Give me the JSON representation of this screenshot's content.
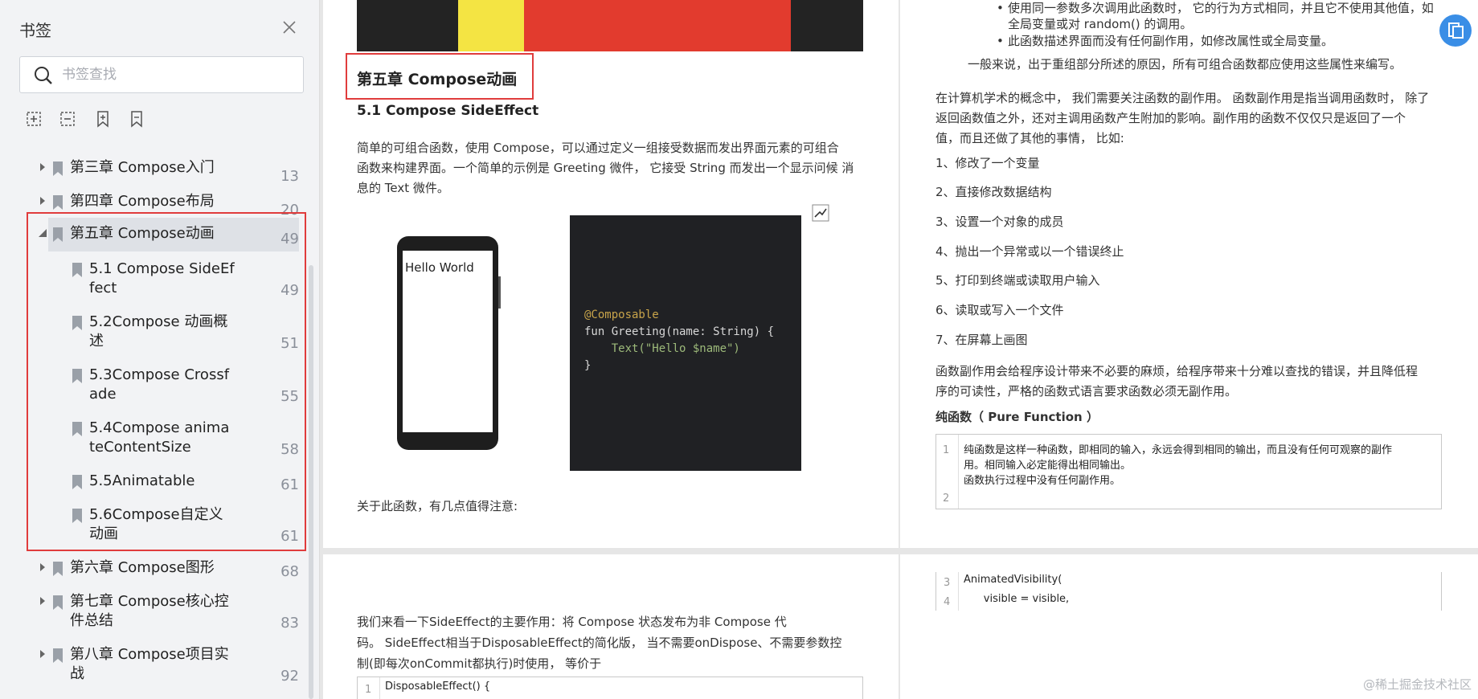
{
  "sidebar": {
    "title": "书签",
    "search_placeholder": "书签查找",
    "items": [
      {
        "label": "第三章 Compose入门",
        "page": "13"
      },
      {
        "label": "第四章 Compose布局",
        "page": "20"
      },
      {
        "label": "第五章 Compose动画",
        "page": "49"
      },
      {
        "label_1": "5.1 Compose SideEf",
        "label_2": "fect",
        "page": "49"
      },
      {
        "label_1": "5.2Compose 动画概",
        "label_2": "述",
        "page": "51"
      },
      {
        "label_1": "5.3Compose Crossf",
        "label_2": "ade",
        "page": "55"
      },
      {
        "label_1": "5.4Compose anima",
        "label_2": "teContentSize",
        "page": "58"
      },
      {
        "label": "5.5Animatable",
        "page": "61"
      },
      {
        "label_1": "5.6Compose自定义",
        "label_2": "动画",
        "page": "61"
      },
      {
        "label": "第六章 Compose图形",
        "page": "68"
      },
      {
        "label_1": "第七章 Compose核心控",
        "label_2": "件总结",
        "page": "83"
      },
      {
        "label_1": "第八章 Compose项目实",
        "label_2": "战",
        "page": "92"
      }
    ]
  },
  "left_page": {
    "chapter_title": "第五章 Compose动画",
    "section_title": "5.1 Compose SideEffect",
    "intro_lines": [
      "简单的可组合函数，使用 Compose，可以通过定义一组接受数据而发出界面元素的可组合",
      "函数来构建界面。一个简单的示例是 Greeting 微件，  它接受 String 而发出一个显示问候 消",
      "息的 Text 微件。"
    ],
    "phone_text": "Hello World",
    "code_lines": [
      "@Composable",
      "fun Greeting(name: String) {",
      "    Text(\"Hello $name\")",
      "}"
    ],
    "note": "关于此函数，有几点值得注意:"
  },
  "right_page": {
    "bullets": [
      "使用同一参数多次调用此函数时，   它的行为方式相同，并且它不使用其他值，如",
      "全局变量或对 random() 的调用。",
      "此函数描述界面而没有任何副作用，如修改属性或全局变量。"
    ],
    "summary": "一般来说，出于重组部分所述的原因，所有可组合函数都应使用这些属性来编写。",
    "concept_lines": [
      "在计算机学术的概念中，  我们需要关注函数的副作用。  函数副作用是指当调用函数时，   除了",
      "返回函数值之外，还对主调用函数产生附加的影响。副作用的函数不仅仅只是返回了一个",
      "值，而且还做了其他的事情，   比如:"
    ],
    "numbered": [
      "1、修改了一个变量",
      "2、直接修改数据结构",
      "3、设置一个对象的成员",
      "4、抛出一个异常或以一个错误终止",
      "5、打印到终端或读取用户输入",
      "6、读取或写入一个文件",
      "7、在屏幕上画图"
    ],
    "side_effect_lines": [
      "函数副作用会给程序设计带来不必要的麻烦，给程序带来十分难以查找的错误，并且降低程",
      "序的可读性，严格的函数式语言要求函数必须无副作用。"
    ],
    "pure_heading": "纯函数（ Pure Function ）",
    "pure_code": {
      "line_nums": [
        "1",
        "2"
      ],
      "lines": [
        "纯函数是这样一种函数，即相同的输入，永远会得到相同的输出，而且没有任何可观察的副作",
        "用。相同输入必定能得出相同输出。",
        "函数执行过程中没有任何副作用。"
      ]
    }
  },
  "bottom_left": {
    "lines": [
      "我们来看一下SideEffect的主要作用：将 Compose 状态发布为非 Compose 代",
      "码。  SideEffect相当于DisposableEffect的简化版，  当不需要onDispose、不需要参数控",
      "制(即每次onCommit都执行)时使用，  等价于"
    ],
    "code_line_num": "1",
    "code_line": "DisposableEffect() {"
  },
  "bottom_right": {
    "line_nums": [
      "3",
      "4"
    ],
    "lines": [
      "AnimatedVisibility(",
      "      visible = visible,"
    ]
  },
  "watermark": "@稀土掘金技术社区"
}
